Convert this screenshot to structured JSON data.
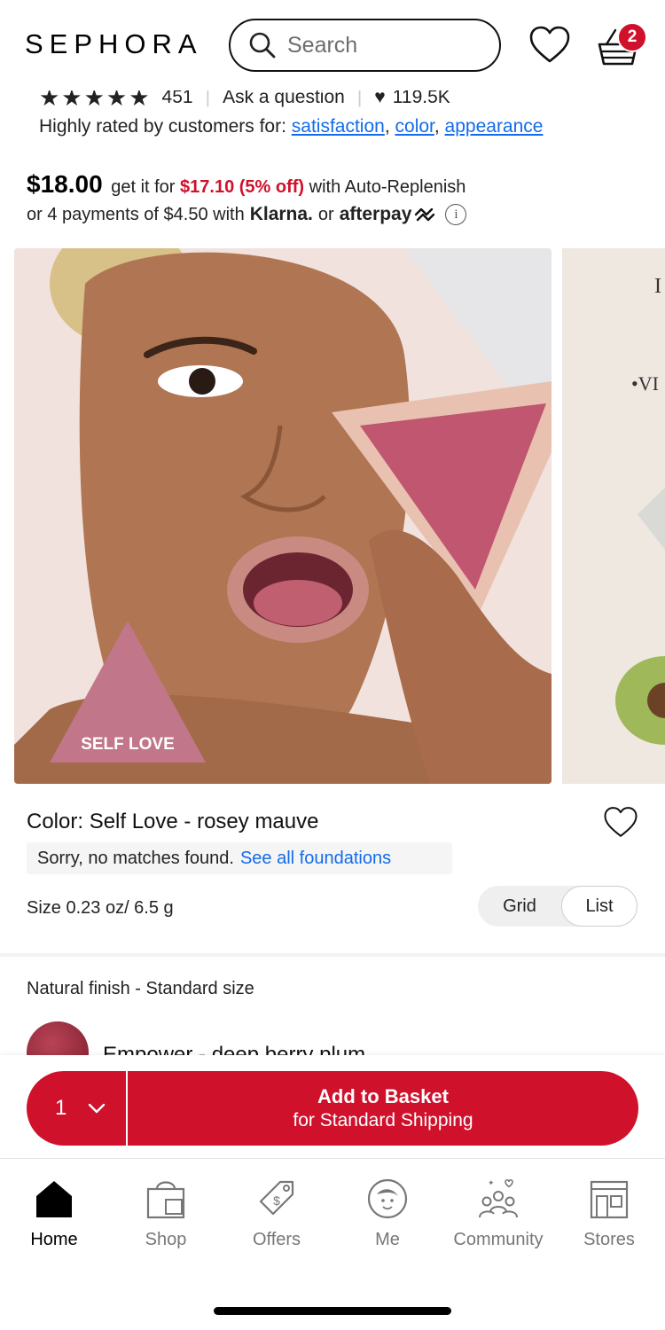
{
  "header": {
    "logo": "SEPHORA",
    "search_placeholder": "Search",
    "basket_count": "2"
  },
  "reviews": {
    "stars": "★★★★★",
    "review_count": "451",
    "ask_question": "Ask a question",
    "loves": "119.5K",
    "highlights_prefix": "Highly rated by customers for:",
    "highlights": [
      "satisfaction",
      "color",
      "appearance"
    ]
  },
  "price": {
    "regular": "$18.00",
    "get_it_for": "get it for",
    "sale": "$17.10 (5% off)",
    "with_autoreplenish": "with Auto-Replenish",
    "payments_text": "or 4 payments of $4.50 with",
    "klarna": "Klarna.",
    "or": "or",
    "afterpay": "afterpay"
  },
  "hero": {
    "swatch_label": "SELF LOVE",
    "next_text_1": "I",
    "next_text_2": "•VI"
  },
  "product": {
    "color_label": "Color: Self Love - rosey mauve",
    "no_match": "Sorry, no matches found.",
    "see_all": "See all foundations",
    "size": "Size 0.23 oz/ 6.5 g",
    "view_grid": "Grid",
    "view_list": "List",
    "finish_label": "Natural finish - Standard size",
    "next_swatch_name": "Empower - deep berry plum"
  },
  "cta": {
    "quantity": "1",
    "line1": "Add to Basket",
    "line2": "for Standard Shipping"
  },
  "nav": {
    "items": [
      {
        "label": "Home"
      },
      {
        "label": "Shop"
      },
      {
        "label": "Offers"
      },
      {
        "label": "Me"
      },
      {
        "label": "Community"
      },
      {
        "label": "Stores"
      }
    ]
  },
  "colors": {
    "brand_red": "#cf112c",
    "link_blue": "#136bea"
  }
}
